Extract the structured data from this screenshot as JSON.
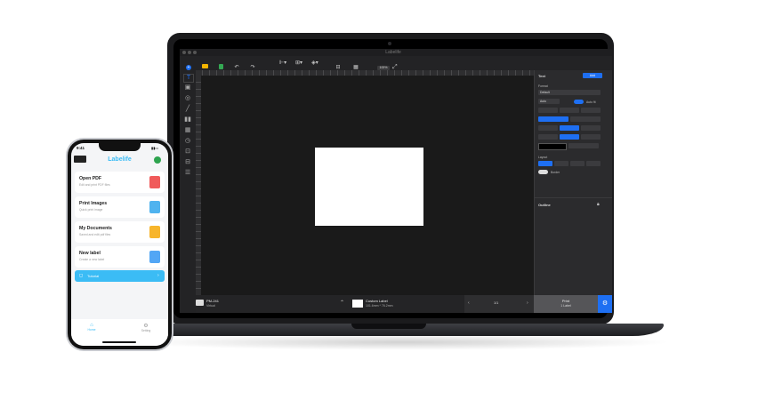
{
  "mac_app": {
    "window_title": "Labelife",
    "toolbar": [
      {
        "label": "New"
      },
      {
        "label": "Open"
      },
      {
        "label": "Save"
      },
      {
        "label": "Undo"
      },
      {
        "label": "Redo"
      },
      {
        "label": ""
      },
      {
        "label": ""
      },
      {
        "label": ""
      },
      {
        "label": "Insert table"
      },
      {
        "label": "View data"
      }
    ],
    "zoom": "100%",
    "left_tools": [
      "text-tool",
      "image-tool",
      "shape-tool",
      "line-tool",
      "barcode-tool",
      "qrcode-tool",
      "time-tool",
      "serial-tool",
      "table-tool",
      "form-tool"
    ],
    "right_panel": {
      "section_title": "Text",
      "add_button": "Add",
      "format_title": "Format",
      "font_value": "Default",
      "size_value": "Auto",
      "autofit_label": "Auto fit",
      "layout_title": "Layout",
      "border_label": "Border",
      "outline_title": "Outline"
    },
    "status": {
      "printer_name": "PM-241",
      "printer_sub": "Virtual",
      "label_name": "Custom Label",
      "label_size": "101.6mm * 76.2mm",
      "page": "1/1",
      "print_label": "Print",
      "print_count": "1 Label"
    },
    "colors": {
      "accent": "#1e6ff2",
      "canvas": "#1a1a1a"
    }
  },
  "phone_app": {
    "time": "9:41",
    "app_title": "Labelife",
    "cards": [
      {
        "title": "Open PDF",
        "subtitle": "Edit and print PDF files",
        "icon_color": "#f05a5a"
      },
      {
        "title": "Print Images",
        "subtitle": "Quick print image",
        "icon_color": "#4fb3ef"
      },
      {
        "title": "My Documents",
        "subtitle": "Saved and edit pdf files",
        "icon_color": "#f7b52c"
      },
      {
        "title": "New label",
        "subtitle": "Create a new label",
        "icon_color": "#52a6f5"
      }
    ],
    "tutorial_label": "Tutorial",
    "tabs": [
      {
        "label": "Home"
      },
      {
        "label": "Setting"
      }
    ],
    "accent": "#3bbcf5"
  }
}
